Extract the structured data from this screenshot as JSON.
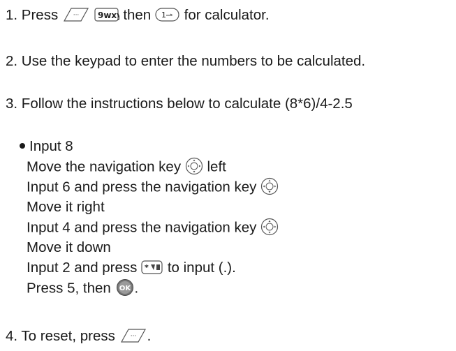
{
  "steps": {
    "s1": {
      "a": "1. Press",
      "b": "then",
      "c": "for calculator."
    },
    "s2": "2. Use the keypad to enter the numbers to be calculated.",
    "s3": "3. Follow the instructions below to calculate (8*6)/4-2.5",
    "sub": {
      "l1": "Input 8",
      "l2a": "Move the navigation key",
      "l2b": "left",
      "l3": "Input 6 and press the navigation key",
      "l4": "Move it right",
      "l5": "Input 4 and press the navigation key",
      "l6": "Move it down",
      "l7a": "Input 2 and press",
      "l7b": "to input (.).",
      "l8a": "Press 5, then",
      "l8b": "."
    },
    "s4": {
      "a": "4. To reset, press",
      "b": "."
    }
  },
  "key_labels": {
    "nine": "9wxyz",
    "one": "1",
    "star": "*",
    "ok": "OK"
  },
  "icons": [
    "menu-key-icon",
    "nine-key-icon",
    "one-key-icon",
    "navigation-key-icon",
    "star-key-icon",
    "ok-key-icon"
  ]
}
